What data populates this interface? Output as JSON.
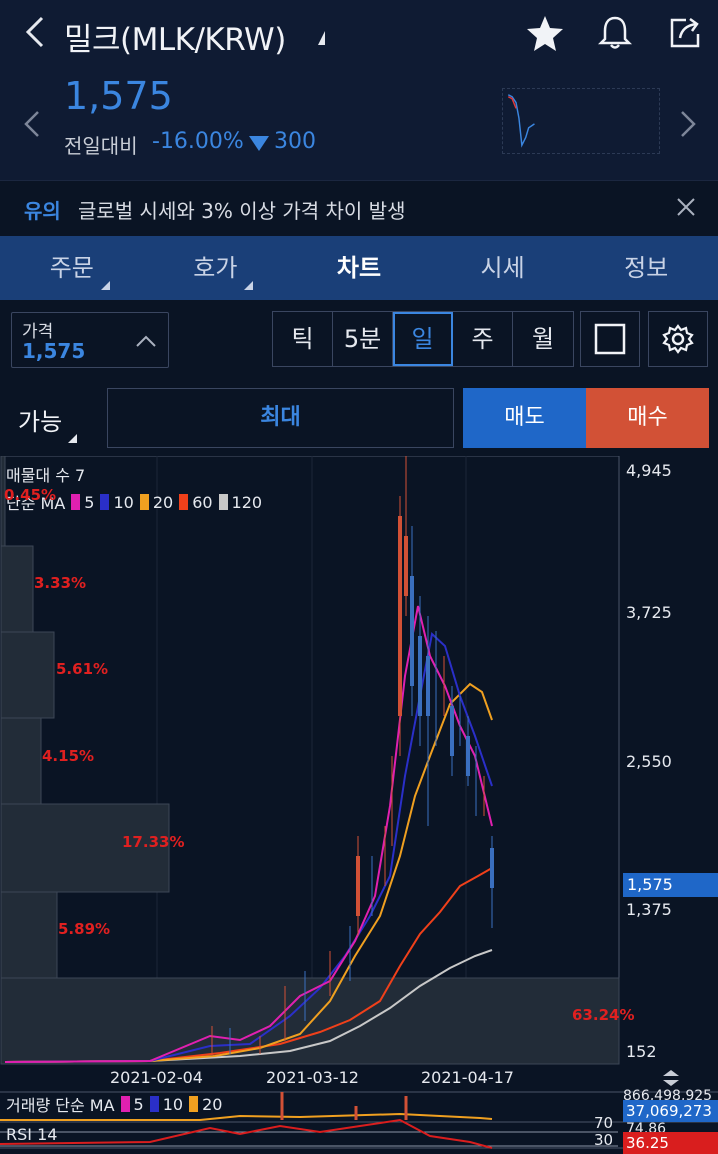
{
  "header": {
    "title": "밀크(MLK/KRW)",
    "price": "1,575",
    "change_label": "전일대비",
    "change_pct": "-16.00%",
    "change_amount": "300"
  },
  "notice": {
    "tag": "유의",
    "text": "글로벌 시세와 3% 이상 가격 차이 발생"
  },
  "tabs": [
    {
      "label": "주문"
    },
    {
      "label": "호가"
    },
    {
      "label": "차트"
    },
    {
      "label": "시세"
    },
    {
      "label": "정보"
    }
  ],
  "controls": {
    "price_label": "가격",
    "price_value": "1,575",
    "periods": [
      "틱",
      "5분",
      "일",
      "주",
      "월"
    ],
    "active_period": "일"
  },
  "order": {
    "avail_label": "가능",
    "max_label": "최대",
    "sell_label": "매도",
    "buy_label": "매수"
  },
  "chart": {
    "overlay_title": "매물대 수 7",
    "ma_label": "단순 MA",
    "ma_periods": [
      "5",
      "10",
      "20",
      "60",
      "120"
    ],
    "ma_colors": [
      "#e020b0",
      "#2a2fc8",
      "#f0a020",
      "#f0401a",
      "#c8c8c8"
    ],
    "volume_profile_pct": [
      "0.45%",
      "3.33%",
      "5.61%",
      "4.15%",
      "17.33%",
      "5.89%",
      "63.24%"
    ],
    "y_ticks": [
      "4,945",
      "3,725",
      "2,550",
      "1,375",
      "152"
    ],
    "current_price": "1,575",
    "x_ticks": [
      "2021-02-04",
      "2021-03-12",
      "2021-04-17"
    ],
    "volume_label": "거래량 단순 MA",
    "volume_ma_periods": [
      "5",
      "10",
      "20"
    ],
    "volume_top": "866,498,925",
    "volume_current": "37,069,273",
    "volume_low": "74.86",
    "rsi_label": "RSI 14",
    "rsi_levels": [
      "70",
      "30"
    ],
    "rsi_current": "36.25"
  },
  "colors": {
    "accent_blue": "#3b86e0",
    "down_blue": "#1f67c8",
    "up_red": "#d25136",
    "tab_bg": "#1a3f78"
  }
}
